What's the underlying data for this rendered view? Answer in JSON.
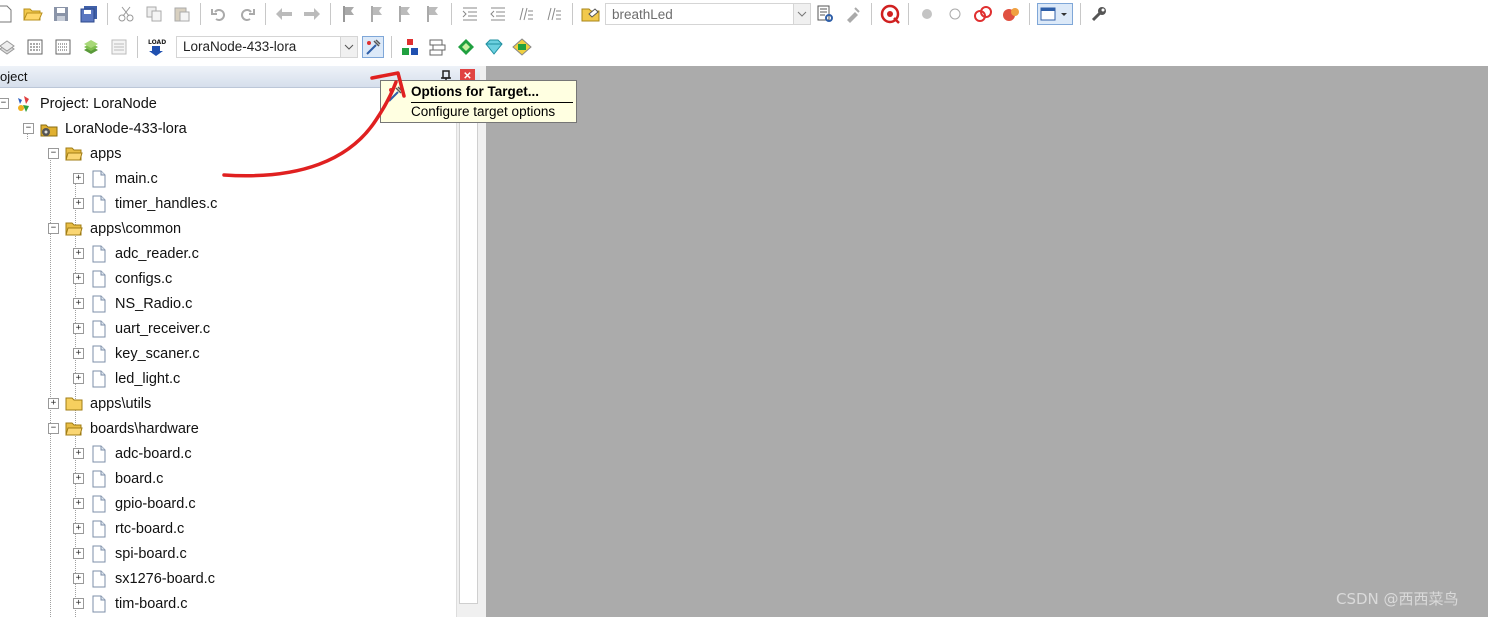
{
  "toolbar1": {
    "target_combo_value": "breathLed"
  },
  "toolbar2": {
    "target_combo_value": "LoraNode-433-lora"
  },
  "project_pane": {
    "title": "oject",
    "tree": [
      {
        "label": "Project: LoraNode",
        "level": 0,
        "type": "project",
        "expander": "minus"
      },
      {
        "label": "LoraNode-433-lora",
        "level": 1,
        "type": "target",
        "expander": "minus"
      },
      {
        "label": "apps",
        "level": 2,
        "type": "folder-open",
        "expander": "minus"
      },
      {
        "label": "main.c",
        "level": 3,
        "type": "file",
        "expander": "plus"
      },
      {
        "label": "timer_handles.c",
        "level": 3,
        "type": "file",
        "expander": "plus"
      },
      {
        "label": "apps\\common",
        "level": 2,
        "type": "folder-open",
        "expander": "minus"
      },
      {
        "label": "adc_reader.c",
        "level": 3,
        "type": "file",
        "expander": "plus"
      },
      {
        "label": "configs.c",
        "level": 3,
        "type": "file",
        "expander": "plus"
      },
      {
        "label": "NS_Radio.c",
        "level": 3,
        "type": "file",
        "expander": "plus"
      },
      {
        "label": "uart_receiver.c",
        "level": 3,
        "type": "file",
        "expander": "plus"
      },
      {
        "label": "key_scaner.c",
        "level": 3,
        "type": "file",
        "expander": "plus"
      },
      {
        "label": "led_light.c",
        "level": 3,
        "type": "file",
        "expander": "plus"
      },
      {
        "label": "apps\\utils",
        "level": 2,
        "type": "folder",
        "expander": "plus"
      },
      {
        "label": "boards\\hardware",
        "level": 2,
        "type": "folder-open",
        "expander": "minus"
      },
      {
        "label": "adc-board.c",
        "level": 3,
        "type": "file",
        "expander": "plus"
      },
      {
        "label": "board.c",
        "level": 3,
        "type": "file",
        "expander": "plus"
      },
      {
        "label": "gpio-board.c",
        "level": 3,
        "type": "file",
        "expander": "plus"
      },
      {
        "label": "rtc-board.c",
        "level": 3,
        "type": "file",
        "expander": "plus"
      },
      {
        "label": "spi-board.c",
        "level": 3,
        "type": "file",
        "expander": "plus"
      },
      {
        "label": "sx1276-board.c",
        "level": 3,
        "type": "file",
        "expander": "plus"
      },
      {
        "label": "tim-board.c",
        "level": 3,
        "type": "file",
        "expander": "plus"
      }
    ]
  },
  "tooltip": {
    "title": "Options for Target...",
    "description": "Configure target options"
  },
  "watermark": "CSDN @西西菜鸟",
  "colors": {
    "workspace": "#ababab",
    "tooltip_bg": "#ffffe1",
    "annotation": "#e02020",
    "close_button": "#e04343"
  }
}
